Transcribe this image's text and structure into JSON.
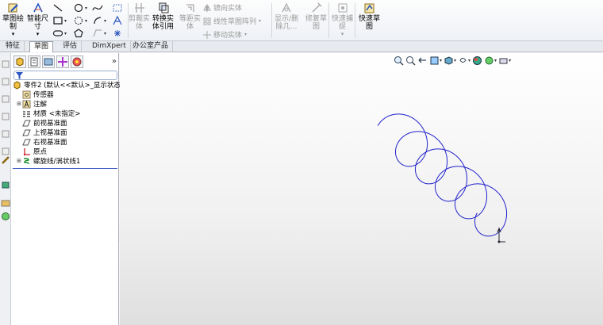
{
  "ribbon": {
    "sketch": "草图绘\n制",
    "smart_dim": "智能尺\n寸",
    "cut_entities": "剪裁实\n体",
    "convert_entities": "转换实\n体引用",
    "offset_entities": "等距实\n体",
    "mirror_entities": "镜向实体",
    "linear_pattern": "线性草图阵列",
    "move_entities": "移动实体",
    "show_delete": "显示/删\n除几…",
    "repair_sketch": "修复草\n图",
    "quick_snaps": "快速捕\n捉",
    "rapid_sketch": "快速草\n图"
  },
  "tabs": [
    "特征",
    "草图",
    "评估",
    "DimXpert",
    "办公室产品"
  ],
  "active_tab": "草图",
  "tree": {
    "root": "零件2  (默认<<默认>_显示状态",
    "items": [
      {
        "label": "传感器",
        "icon": "sensor-icon",
        "expandable": false
      },
      {
        "label": "注解",
        "icon": "annotation-icon",
        "expandable": true
      },
      {
        "label": "材质 <未指定>",
        "icon": "material-icon",
        "expandable": false
      },
      {
        "label": "前视基准面",
        "icon": "plane-icon",
        "expandable": false
      },
      {
        "label": "上视基准面",
        "icon": "plane-icon",
        "expandable": false
      },
      {
        "label": "右视基准面",
        "icon": "plane-icon",
        "expandable": false
      },
      {
        "label": "原点",
        "icon": "origin-icon",
        "expandable": false
      },
      {
        "label": "螺旋线/涡状线1",
        "icon": "helix-icon",
        "expandable": true
      }
    ]
  },
  "colors": {
    "helix": "#2222cc",
    "accent": "#3b57c4"
  }
}
